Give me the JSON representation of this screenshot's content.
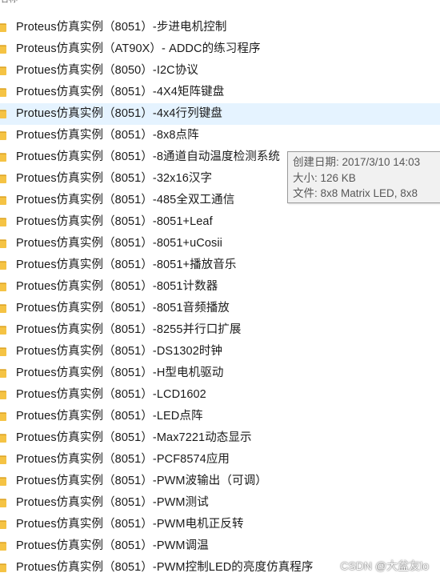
{
  "header": {
    "partial_label": "名称"
  },
  "rows": [
    "Proteus仿真实例（8051）-步进电机控制",
    "Proteus仿真实例（AT90X）- ADDC的练习程序",
    "Protues仿真实例（8050）-I2C协议",
    "Protues仿真实例（8051）-4X4矩阵键盘",
    "Protues仿真实例（8051）-4x4行列键盘",
    "Protues仿真实例（8051）-8x8点阵",
    "Protues仿真实例（8051）-8通道自动温度检测系统",
    "Protues仿真实例（8051）-32x16汉字",
    "Protues仿真实例（8051）-485全双工通信",
    "Protues仿真实例（8051）-8051+Leaf",
    "Protues仿真实例（8051）-8051+uCosii",
    "Protues仿真实例（8051）-8051+播放音乐",
    "Protues仿真实例（8051）-8051计数器",
    "Protues仿真实例（8051）-8051音频播放",
    "Protues仿真实例（8051）-8255并行口扩展",
    "Protues仿真实例（8051）-DS1302时钟",
    "Protues仿真实例（8051）-H型电机驱动",
    "Protues仿真实例（8051）-LCD1602",
    "Protues仿真实例（8051）-LED点阵",
    "Protues仿真实例（8051）-Max7221动态显示",
    "Protues仿真实例（8051）-PCF8574应用",
    "Protues仿真实例（8051）-PWM波输出（可调）",
    "Protues仿真实例（8051）-PWM测试",
    "Protues仿真实例（8051）-PWM电机正反转",
    "Protues仿真实例（8051）-PWM调温",
    "Protues仿真实例（8051）-PWM控制LED的亮度仿真程序"
  ],
  "hover_index": 4,
  "tooltip": {
    "created": "创建日期: 2017/3/10 14:03",
    "size": "大小: 126 KB",
    "files": "文件: 8x8 Matrix LED, 8x8"
  },
  "watermark": "CSDN @大盆友lo",
  "colors": {
    "hover_bg": "#e5f3ff",
    "folder": "#f5c344",
    "folder_dark": "#e0a82a"
  },
  "icon": "folder-icon"
}
